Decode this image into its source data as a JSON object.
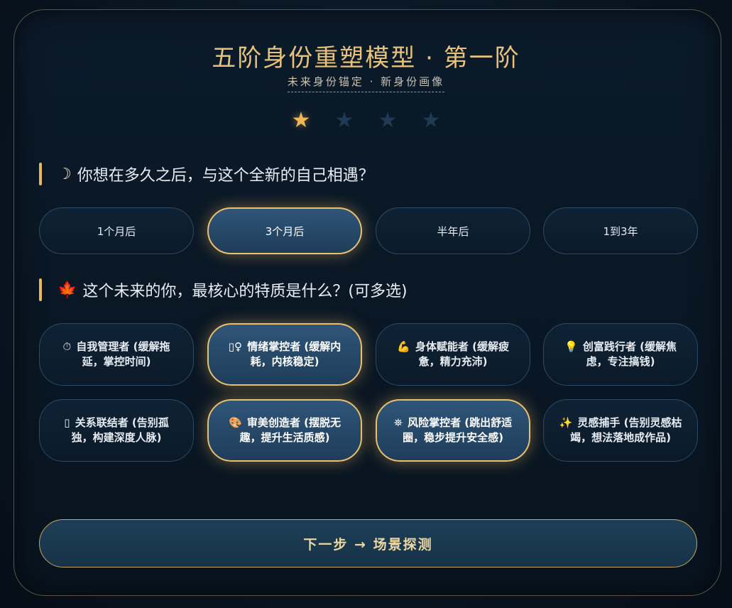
{
  "header": {
    "title": "五阶身份重塑模型 · 第一阶",
    "subtitle": "未来身份锚定 · 新身份画像"
  },
  "progress": {
    "total_steps": 4,
    "current_step": 1,
    "star_glyph": "★"
  },
  "question1": {
    "icon": "crescent-moon-icon",
    "icon_glyph": "☽",
    "text": "你想在多久之后，与这个全新的自己相遇？",
    "options": [
      {
        "label": "1个月后",
        "selected": false
      },
      {
        "label": "3个月后",
        "selected": true
      },
      {
        "label": "半年后",
        "selected": false
      },
      {
        "label": "1到3年",
        "selected": false
      }
    ]
  },
  "question2": {
    "icon": "maple-leaf-icon",
    "icon_glyph": "🍁",
    "text": "这个未来的你，最核心的特质是什么？(可多选)",
    "options": [
      {
        "icon": "stopwatch-icon",
        "glyph": "⏱",
        "label": "自我管理者 (缓解拖延，掌控时间)",
        "selected": false
      },
      {
        "icon": "emotion-icon",
        "glyph": "▯♀",
        "label": "情绪掌控者 (缓解内耗，内核稳定)",
        "selected": true
      },
      {
        "icon": "flexed-biceps-icon",
        "glyph": "💪",
        "label": "身体赋能者 (缓解疲惫，精力充沛)",
        "selected": false
      },
      {
        "icon": "light-bulb-icon",
        "glyph": "💡",
        "label": "创富践行者 (缓解焦虑，专注搞钱)",
        "selected": false
      },
      {
        "icon": "people-icon",
        "glyph": "▯",
        "label": "关系联结者 (告别孤独，构建深度人脉)",
        "selected": false
      },
      {
        "icon": "palette-icon",
        "glyph": "🎨",
        "label": "审美创造者 (摆脱无趣，提升生活质感)",
        "selected": true
      },
      {
        "icon": "binoculars-icon",
        "glyph": "⛯",
        "label": "风险掌控者 (跳出舒适圈，稳步提升安全感)",
        "selected": true
      },
      {
        "icon": "sparkles-icon",
        "glyph": "✨",
        "label": "灵感捕手 (告别灵感枯竭，想法落地成作品)",
        "selected": false
      }
    ]
  },
  "footer": {
    "next_label": "下一步 → 场景探测"
  },
  "colors": {
    "accent_gold": "#e8c27a",
    "selected_border": "#e8c070",
    "inactive_star": "#1e3a55",
    "active_star": "#f0b755"
  }
}
